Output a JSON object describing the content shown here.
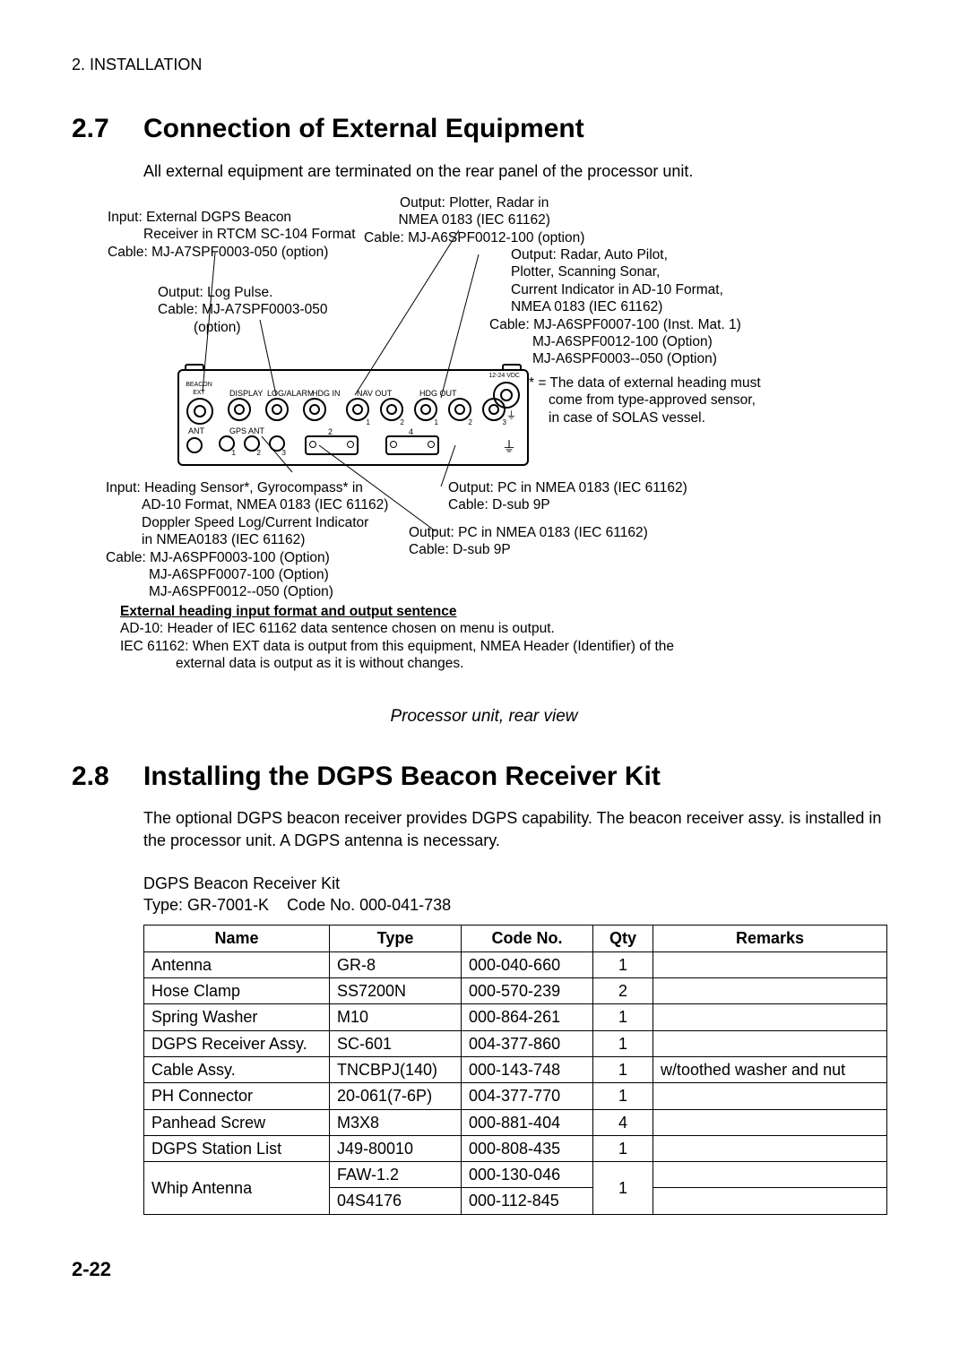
{
  "header": "2. INSTALLATION",
  "section27": {
    "num": "2.7",
    "title": "Connection of External Equipment",
    "intro": "All external equipment are terminated on the rear panel of the processor unit."
  },
  "diagram": {
    "topLeft": {
      "l1": "Input: External DGPS Beacon",
      "l2": "Receiver in RTCM SC-104 Format",
      "l3": "Cable: MJ-A7SPF0003-050 (option)"
    },
    "topMid": {
      "l1": "Output: Plotter, Radar in",
      "l2": "NMEA 0183 (IEC 61162)",
      "l3": "Cable: MJ-A6SPF0012-100 (option)"
    },
    "topRight": {
      "l1": "Output: Radar, Auto Pilot,",
      "l2": "Plotter, Scanning Sonar,",
      "l3": "Current Indicator in AD-10 Format,",
      "l4": "NMEA 0183 (IEC 61162)",
      "l5": "Cable: MJ-A6SPF0007-100 (Inst. Mat. 1)",
      "l6": "MJ-A6SPF0012-100 (Option)",
      "l7": "MJ-A6SPF0003--050 (Option)"
    },
    "midLeft": {
      "l1": "Output: Log Pulse.",
      "l2": "Cable: MJ-A7SPF0003-050",
      "l3": "(option)"
    },
    "starNote": {
      "l1": "* = The data of external heading must",
      "l2": "come from type-approved sensor,",
      "l3": "in case of SOLAS vessel."
    },
    "botLeft": {
      "l1": "Input: Heading Sensor*, Gyrocompass* in",
      "l2": "AD-10 Format, NMEA 0183 (IEC 61162)",
      "l3": "Doppler Speed Log/Current Indicator",
      "l4": "in NMEA0183 (IEC 61162)",
      "l5": "Cable: MJ-A6SPF0003-100 (Option)",
      "l6": "MJ-A6SPF0007-100 (Option)",
      "l7": "MJ-A6SPF0012--050 (Option)"
    },
    "botRight1": {
      "l1": "Output: PC in NMEA 0183 (IEC 61162)",
      "l2": "Cable: D-sub 9P"
    },
    "botRight2": {
      "l1": "Output: PC in NMEA 0183 (IEC 61162)",
      "l2": "Cable: D-sub 9P"
    },
    "extHeading": {
      "bold": "External heading input format and output sentence",
      "l1": "AD-10: Header of IEC 61162 data sentence chosen on menu is output.",
      "l2": "IEC 61162: When EXT data is output from this equipment, NMEA Header (Identifier) of the",
      "l3": "external data is output as it is without changes."
    },
    "panelLabels": {
      "vdc": "12-24 VDC",
      "beacon": "BEACON",
      "ext": "EXT",
      "display": "DISPLAY",
      "logalarm": "LOG/ALARM",
      "hdgin": "HDG IN",
      "navout": "NAV OUT",
      "hdgout": "HDG OUT",
      "ant": "ANT",
      "gpsant": "GPS ANT"
    },
    "caption": "Processor unit, rear view"
  },
  "section28": {
    "num": "2.8",
    "title": "Installing the DGPS Beacon Receiver Kit",
    "intro": "The optional DGPS beacon receiver provides DGPS capability. The beacon receiver assy. is installed in the processor unit. A DGPS antenna is necessary.",
    "kitName": "DGPS Beacon Receiver Kit",
    "kitType": "Type: GR-7001-K    Code No. 000-041-738"
  },
  "table": {
    "headers": {
      "name": "Name",
      "type": "Type",
      "code": "Code No.",
      "qty": "Qty",
      "remarks": "Remarks"
    },
    "rows": [
      {
        "name": "Antenna",
        "type": "GR-8",
        "code": "000-040-660",
        "qty": "1",
        "remarks": ""
      },
      {
        "name": "Hose Clamp",
        "type": "SS7200N",
        "code": "000-570-239",
        "qty": "2",
        "remarks": ""
      },
      {
        "name": "Spring Washer",
        "type": "M10",
        "code": "000-864-261",
        "qty": "1",
        "remarks": ""
      },
      {
        "name": "DGPS Receiver Assy.",
        "type": "SC-601",
        "code": "004-377-860",
        "qty": "1",
        "remarks": ""
      },
      {
        "name": "Cable Assy.",
        "type": "TNCBPJ(140)",
        "code": "000-143-748",
        "qty": "1",
        "remarks": "w/toothed washer and nut"
      },
      {
        "name": "PH Connector",
        "type": "20-061(7-6P)",
        "code": "004-377-770",
        "qty": "1",
        "remarks": ""
      },
      {
        "name": "Panhead Screw",
        "type": "M3X8",
        "code": "000-881-404",
        "qty": "4",
        "remarks": ""
      },
      {
        "name": "DGPS Station List",
        "type": "J49-80010",
        "code": "000-808-435",
        "qty": "1",
        "remarks": ""
      }
    ],
    "whip": {
      "name": "Whip Antenna",
      "row1": {
        "type": "FAW-1.2",
        "code": "000-130-046"
      },
      "row2": {
        "type": "04S4176",
        "code": "000-112-845"
      },
      "qty": "1",
      "remarks1": "",
      "remarks2": ""
    }
  },
  "pageFooter": "2-22"
}
